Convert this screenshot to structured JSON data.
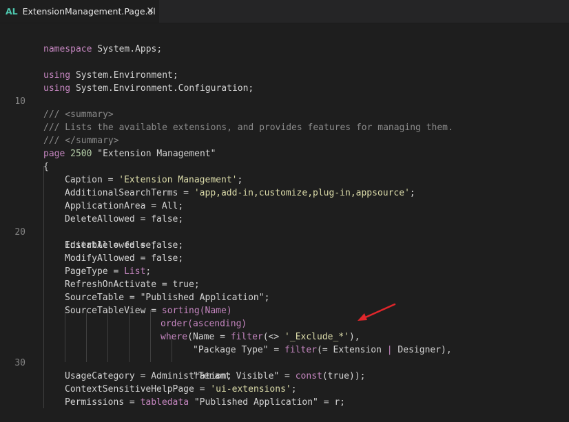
{
  "tab": {
    "lang_badge": "AL",
    "filename": "ExtensionManagement.Page.al",
    "close_glyph": "✕"
  },
  "gutter": {
    "line_10": "10",
    "line_20": "20",
    "line_30": "30"
  },
  "code": {
    "l1": {
      "kw": "namespace",
      "rest": " System.Apps;"
    },
    "l3": {
      "kw": "using",
      "rest": " System.Environment;"
    },
    "l4": {
      "kw": "using",
      "rest": " System.Environment.Configuration;"
    },
    "l6": "/// <summary>",
    "l7": "/// Lists the available extensions, and provides features for managing them.",
    "l8": "/// </summary>",
    "l9": {
      "kw": "page",
      "num": "2500",
      "name": "\"Extension Management\""
    },
    "l10": "{",
    "l11": {
      "prop": "Caption = ",
      "val": "'Extension Management'",
      "end": ";"
    },
    "l12": {
      "prop": "AdditionalSearchTerms = ",
      "val": "'app,add-in,customize,plug-in,appsource'",
      "end": ";"
    },
    "l13": "ApplicationArea = All;",
    "l14": "DeleteAllowed = false;",
    "l15": "Editable = false;",
    "l16": "InsertAllowed = false;",
    "l17": "ModifyAllowed = false;",
    "l18": {
      "prop": "PageType = ",
      "val": "List",
      "end": ";"
    },
    "l19": "RefreshOnActivate = true;",
    "l20": "SourceTable = \"Published Application\";",
    "l21": {
      "prop": "SourceTableView = ",
      "fn": "sorting",
      "arg": "(Name)"
    },
    "l22": {
      "fn": "order",
      "arg": "(ascending)"
    },
    "l23": {
      "fn": "where",
      "a": "(Name = ",
      "fn2": "filter",
      "b": "(<> ",
      "s": "'_Exclude_*'",
      "c": "),"
    },
    "l24": {
      "a": "\"Package Type\" = ",
      "fn": "filter",
      "b": "(= Extension ",
      "bar": "|",
      "c": " Designer),"
    },
    "l25": {
      "a": "\"Tenant Visible\" = ",
      "fn": "const",
      "b": "(true));"
    },
    "l26": "UsageCategory = Administration;",
    "l27": {
      "prop": "ContextSensitiveHelpPage = ",
      "val": "'ui-extensions'",
      "end": ";"
    },
    "l28": {
      "prop": "Permissions = ",
      "kw": "tabledata",
      "rest": " \"Published Application\" = r;"
    }
  },
  "colors": {
    "background": "#1e1e1e",
    "tab_bar": "#252526",
    "keyword": "#c586c0",
    "string": "#dcdcaa",
    "doc_comment": "#8a8a8a",
    "arrow": "#e0262b"
  }
}
